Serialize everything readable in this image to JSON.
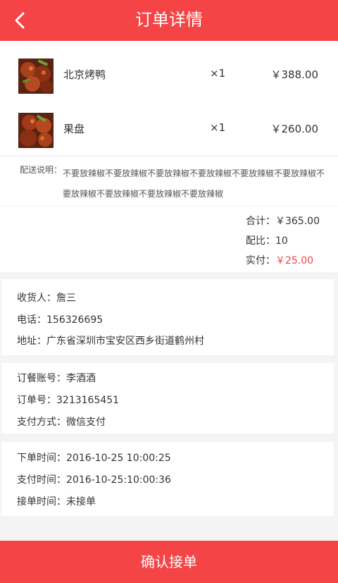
{
  "header": {
    "title": "订单详情"
  },
  "items": [
    {
      "name": "北京烤鸭",
      "qty": "×1",
      "price": "￥388.00"
    },
    {
      "name": "果盘",
      "qty": "×1",
      "price": "￥260.00"
    }
  ],
  "delivery": {
    "label": "配送说明：",
    "text": "不要放辣椒不要放辣椒不要放辣椒不要放辣椒不要放辣椒不要放辣椒不要放辣椒不要放辣椒不要放辣椒不要放辣椒"
  },
  "totals": {
    "subtotal_label": "合计：",
    "subtotal": "￥365.00",
    "ratio_label": "配比：",
    "ratio": "10",
    "paid_label": "实付：",
    "paid": "￥25.00"
  },
  "receiver": {
    "name_label": "收货人：",
    "name": "詹三",
    "phone_label": "电话：",
    "phone": "156326695",
    "address_label": "地址：",
    "address": "广东省深圳市宝安区西乡街道鹤州村"
  },
  "account": {
    "account_label": "订餐账号：",
    "account": "李酒酒",
    "order_label": "订单号：",
    "order_no": "3213165451",
    "pay_label": "支付方式：",
    "pay_method": "微信支付"
  },
  "times": {
    "order_time_label": "下单时间：",
    "order_time": "2016-10-25 10:00:25",
    "pay_time_label": "支付时间：",
    "pay_time": "2016-10-25:10:00:36",
    "accept_time_label": "接单时间：",
    "accept_time": "未接单"
  },
  "confirm_label": "确认接单",
  "colors": {
    "primary": "#f44446",
    "background": "#f4f4f4"
  },
  "icons": {
    "back": "chevron-left-icon",
    "food": "food-thumbnail"
  }
}
